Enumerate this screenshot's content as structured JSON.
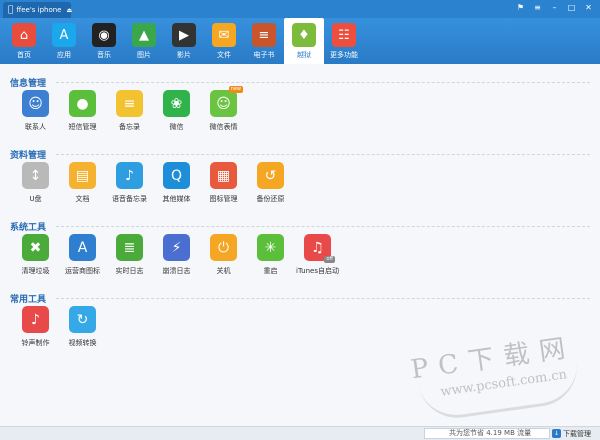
{
  "titlebar": {
    "device_name": "ffee's iphone",
    "controls": [
      {
        "name": "skin-icon",
        "glyph": "⚑"
      },
      {
        "name": "menu-icon",
        "glyph": "≡"
      },
      {
        "name": "minimize-icon",
        "glyph": "–"
      },
      {
        "name": "maximize-icon",
        "glyph": "□"
      },
      {
        "name": "close-icon",
        "glyph": "✕"
      }
    ]
  },
  "toolbar": {
    "items": [
      {
        "key": "home",
        "label": "首页",
        "icon": "store-icon",
        "color": "#e84c3d",
        "glyph": "⌂"
      },
      {
        "key": "apps",
        "label": "应用",
        "icon": "appstore-icon",
        "color": "#1aa7ec",
        "glyph": "A"
      },
      {
        "key": "music",
        "label": "音乐",
        "icon": "music-icon",
        "color": "#222222",
        "glyph": "◉"
      },
      {
        "key": "photos",
        "label": "图片",
        "icon": "photo-icon",
        "color": "#3aa84a",
        "glyph": "▲"
      },
      {
        "key": "videos",
        "label": "影片",
        "icon": "film-icon",
        "color": "#333333",
        "glyph": "▶"
      },
      {
        "key": "files",
        "label": "文件",
        "icon": "folder-icon",
        "color": "#f5a623",
        "glyph": "✉"
      },
      {
        "key": "ebooks",
        "label": "电子书",
        "icon": "book-icon",
        "color": "#c8552b",
        "glyph": "≡"
      },
      {
        "key": "jailbreak",
        "label": "越狱",
        "icon": "pineapple-icon",
        "color": "#7dbb3c",
        "glyph": "♦"
      },
      {
        "key": "more",
        "label": "更多功能",
        "icon": "more-icon",
        "color": "#ee4e3e",
        "glyph": "☷"
      }
    ],
    "active": "jailbreak"
  },
  "sections": [
    {
      "title": "信息管理",
      "items": [
        {
          "label": "联系人",
          "icon": "contacts-icon",
          "color": "#3d7fd0",
          "glyph": "☺"
        },
        {
          "label": "短信管理",
          "icon": "sms-icon",
          "color": "#5cbf3b",
          "glyph": "●"
        },
        {
          "label": "备忘录",
          "icon": "notes-icon",
          "color": "#f2c230",
          "glyph": "≡"
        },
        {
          "label": "微信",
          "icon": "wechat-icon",
          "color": "#2fb34a",
          "glyph": "❀"
        },
        {
          "label": "微信表情",
          "icon": "emoji-icon",
          "color": "#6ac442",
          "glyph": "☺",
          "badge": "new"
        }
      ]
    },
    {
      "title": "资料管理",
      "items": [
        {
          "label": "U盘",
          "icon": "usb-drive-icon",
          "color": "#b9b9b9",
          "glyph": "↕"
        },
        {
          "label": "文档",
          "icon": "document-icon",
          "color": "#f5b130",
          "glyph": "▤"
        },
        {
          "label": "语音备忘录",
          "icon": "microphone-icon",
          "color": "#2f9ee0",
          "glyph": "♪"
        },
        {
          "label": "其他媒体",
          "icon": "quicktime-icon",
          "color": "#1f8ed8",
          "glyph": "Q"
        },
        {
          "label": "图标管理",
          "icon": "icon-manage-icon",
          "color": "#e85a3d",
          "glyph": "▦"
        },
        {
          "label": "备份还原",
          "icon": "backup-icon",
          "color": "#f5a623",
          "glyph": "↺"
        }
      ]
    },
    {
      "title": "系统工具",
      "items": [
        {
          "label": "清理垃圾",
          "icon": "trash-icon",
          "color": "#4aab3a",
          "glyph": "✖"
        },
        {
          "label": "运营商图标",
          "icon": "antenna-icon",
          "color": "#2f7fd0",
          "glyph": "A"
        },
        {
          "label": "实时日志",
          "icon": "log-icon",
          "color": "#4aab3a",
          "glyph": "≣"
        },
        {
          "label": "崩溃日志",
          "icon": "crash-log-icon",
          "color": "#4a6fd0",
          "glyph": "⚡"
        },
        {
          "label": "关机",
          "icon": "power-icon",
          "color": "#f5a623",
          "glyph": "⏻"
        },
        {
          "label": "重启",
          "icon": "restart-icon",
          "color": "#5cbf3b",
          "glyph": "✳"
        },
        {
          "label": "iTunes自启动",
          "icon": "itunes-icon",
          "color": "#e84a4a",
          "glyph": "♫",
          "off": "off"
        }
      ]
    },
    {
      "title": "常用工具",
      "items": [
        {
          "label": "铃声制作",
          "icon": "bell-icon",
          "color": "#e84a4a",
          "glyph": "♪"
        },
        {
          "label": "视频转换",
          "icon": "video-convert-icon",
          "color": "#35a8e8",
          "glyph": "↻"
        }
      ]
    }
  ],
  "watermark": {
    "line1": "PC下载网",
    "line2": "www.pcsoft.com.cn"
  },
  "statusbar": {
    "storage_text": "共为您节省 4.19 MB 流量",
    "download_label": "下载管理"
  }
}
